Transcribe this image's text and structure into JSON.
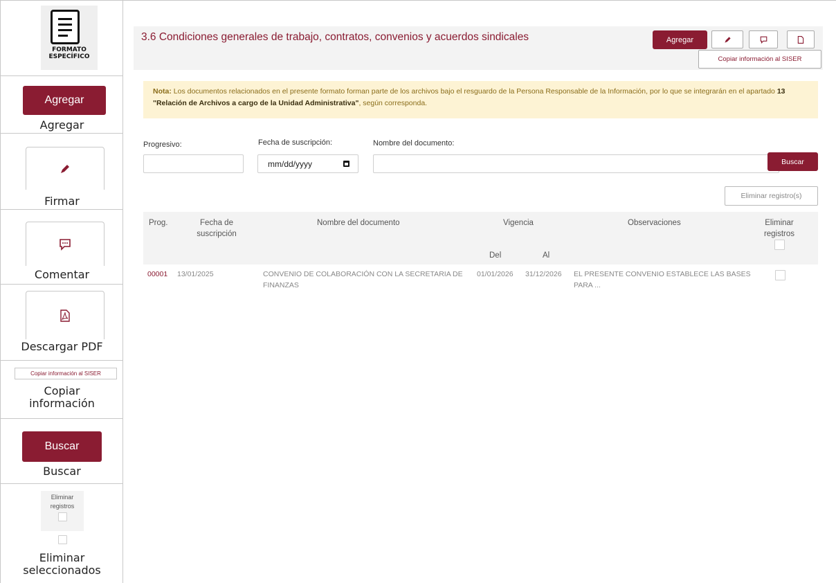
{
  "sidebar": {
    "logo": {
      "text_line1": "FORMATO",
      "text_line2": "ESPECÍFICO",
      "icon": "document-icon"
    },
    "items": [
      {
        "button_label": "Agregar",
        "caption": "Agregar"
      },
      {
        "icon": "pen-icon",
        "caption": "Firmar"
      },
      {
        "icon": "comment-icon",
        "caption": "Comentar"
      },
      {
        "icon": "pdf-icon",
        "caption": "Descargar PDF"
      },
      {
        "button_label": "Copiar información al SISER",
        "caption_line1": "Copiar",
        "caption_line2": "información"
      },
      {
        "button_label": "Buscar",
        "caption": "Buscar"
      },
      {
        "header_line1": "Eliminar",
        "header_line2": "registros",
        "caption_line1": "Eliminar",
        "caption_line2": "seleccionados"
      }
    ]
  },
  "header": {
    "title": "3.6 Condiciones generales de trabajo, contratos, convenios y acuerdos sindicales",
    "add_label": "Agregar",
    "copy_label": "Copiar información al SISER"
  },
  "note": {
    "prefix": "Nota:",
    "text1": "Los documentos relacionados en el presente formato forman parte de los archivos bajo el resguardo de la Persona Responsable de la Información, por lo que se integrarán en el apartado",
    "emphasis": "13 \"Relación de Archivos a cargo de la Unidad Administrativa\"",
    "text2": ", según corresponda."
  },
  "filters": {
    "progresivo_label": "Progresivo:",
    "fecha_label": "Fecha de suscripción:",
    "fecha_placeholder": "mm/dd/yyyy",
    "nombre_label": "Nombre del documento:",
    "search_label": "Buscar",
    "delete_label": "Eliminar registro(s)"
  },
  "table": {
    "headers": {
      "prog": "Prog.",
      "fecha_line1": "Fecha de",
      "fecha_line2": "suscripción",
      "nombre": "Nombre del documento",
      "vigencia": "Vigencia",
      "del": "Del",
      "al": "Al",
      "observaciones": "Observaciones",
      "eliminar_line1": "Eliminar",
      "eliminar_line2": "registros"
    },
    "rows": [
      {
        "prog": "00001",
        "fecha": "13/01/2025",
        "nombre": "CONVENIO DE COLABORACIÓN CON LA SECRETARIA DE FINANZAS",
        "del": "01/01/2026",
        "al": "31/12/2026",
        "observaciones": "EL PRESENTE CONVENIO ESTABLECE LAS BASES PARA ..."
      }
    ]
  },
  "colors": {
    "accent": "#8a1c32",
    "note_bg": "#fdf3d4",
    "header_bg": "#f3f3f3"
  }
}
